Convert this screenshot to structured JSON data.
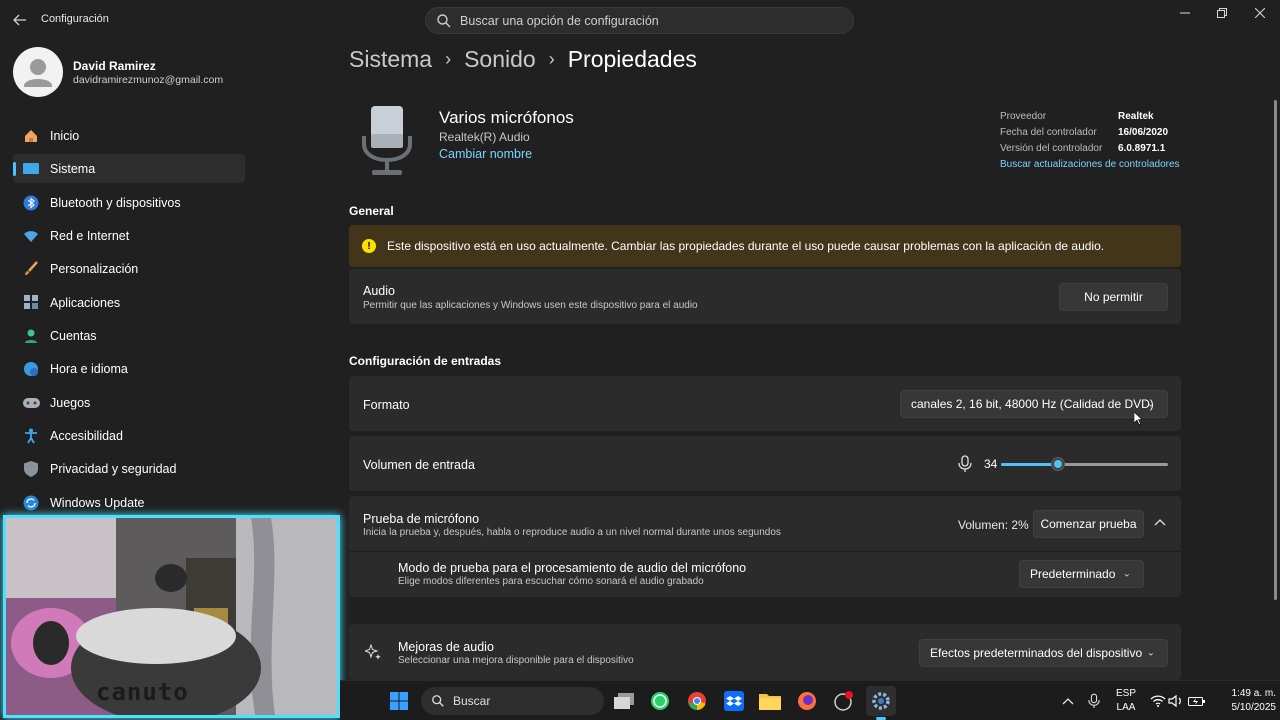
{
  "window": {
    "app_title": "Configuración",
    "search_placeholder": "Buscar una opción de configuración"
  },
  "user": {
    "name": "David Ramirez",
    "email": "davidramirezmunoz@gmail.com"
  },
  "sidebar": {
    "items": [
      {
        "label": "Inicio",
        "icon": "home-icon"
      },
      {
        "label": "Sistema",
        "icon": "system-icon",
        "active": true
      },
      {
        "label": "Bluetooth y dispositivos",
        "icon": "bluetooth-icon"
      },
      {
        "label": "Red e Internet",
        "icon": "wifi-icon"
      },
      {
        "label": "Personalización",
        "icon": "brush-icon"
      },
      {
        "label": "Aplicaciones",
        "icon": "apps-icon"
      },
      {
        "label": "Cuentas",
        "icon": "account-icon"
      },
      {
        "label": "Hora e idioma",
        "icon": "globe-clock-icon"
      },
      {
        "label": "Juegos",
        "icon": "gamepad-icon"
      },
      {
        "label": "Accesibilidad",
        "icon": "accessibility-icon"
      },
      {
        "label": "Privacidad y seguridad",
        "icon": "shield-icon"
      },
      {
        "label": "Windows Update",
        "icon": "update-icon"
      }
    ]
  },
  "breadcrumb": [
    "Sistema",
    "Sonido",
    "Propiedades"
  ],
  "device": {
    "name": "Varios micrófonos",
    "driver_name": "Realtek(R) Audio",
    "rename_link": "Cambiar nombre",
    "props": [
      {
        "label": "Proveedor",
        "value": "Realtek"
      },
      {
        "label": "Fecha del controlador",
        "value": "16/06/2020"
      },
      {
        "label": "Versión del controlador",
        "value": "6.0.8971.1"
      }
    ],
    "update_link": "Buscar actualizaciones de controladores"
  },
  "general": {
    "title": "General",
    "warning": "Este dispositivo está en uso actualmente. Cambiar las propiedades durante el uso puede causar problemas con la aplicación de audio.",
    "audio_title": "Audio",
    "audio_desc": "Permitir que las aplicaciones y Windows usen este dispositivo para el audio",
    "audio_button": "No permitir"
  },
  "input": {
    "title": "Configuración de entradas",
    "format_label": "Formato",
    "format_value": "canales 2, 16 bit, 48000 Hz (Calidad de DVD)",
    "volume_label": "Volumen de entrada",
    "volume_value": "34",
    "volume_level": 0.34,
    "test_title": "Prueba de micrófono",
    "test_desc": "Inicia la prueba y, después, habla o reproduce audio a un nivel normal durante unos segundos",
    "test_volume": "Volumen: 2%",
    "test_button": "Comenzar prueba",
    "mode_title": "Modo de prueba para el procesamiento de audio del micrófono",
    "mode_desc": "Elige modos diferentes para escuchar cómo sonará el audio grabado",
    "mode_value": "Predeterminado",
    "enh_title": "Mejoras de audio",
    "enh_desc": "Seleccionar una mejora disponible para el dispositivo",
    "enh_value": "Efectos predeterminados del dispositivo"
  },
  "webcam": {
    "overlay_text": "canuto"
  },
  "taskbar": {
    "search_label": "Buscar",
    "lang_1": "ESP",
    "lang_2": "LAA",
    "time": "1:49 a. m.",
    "date": "5/10/2025"
  },
  "colors": {
    "accent": "#4cc2ff",
    "link": "#7dd3ff",
    "warning_bg": "#433519"
  }
}
